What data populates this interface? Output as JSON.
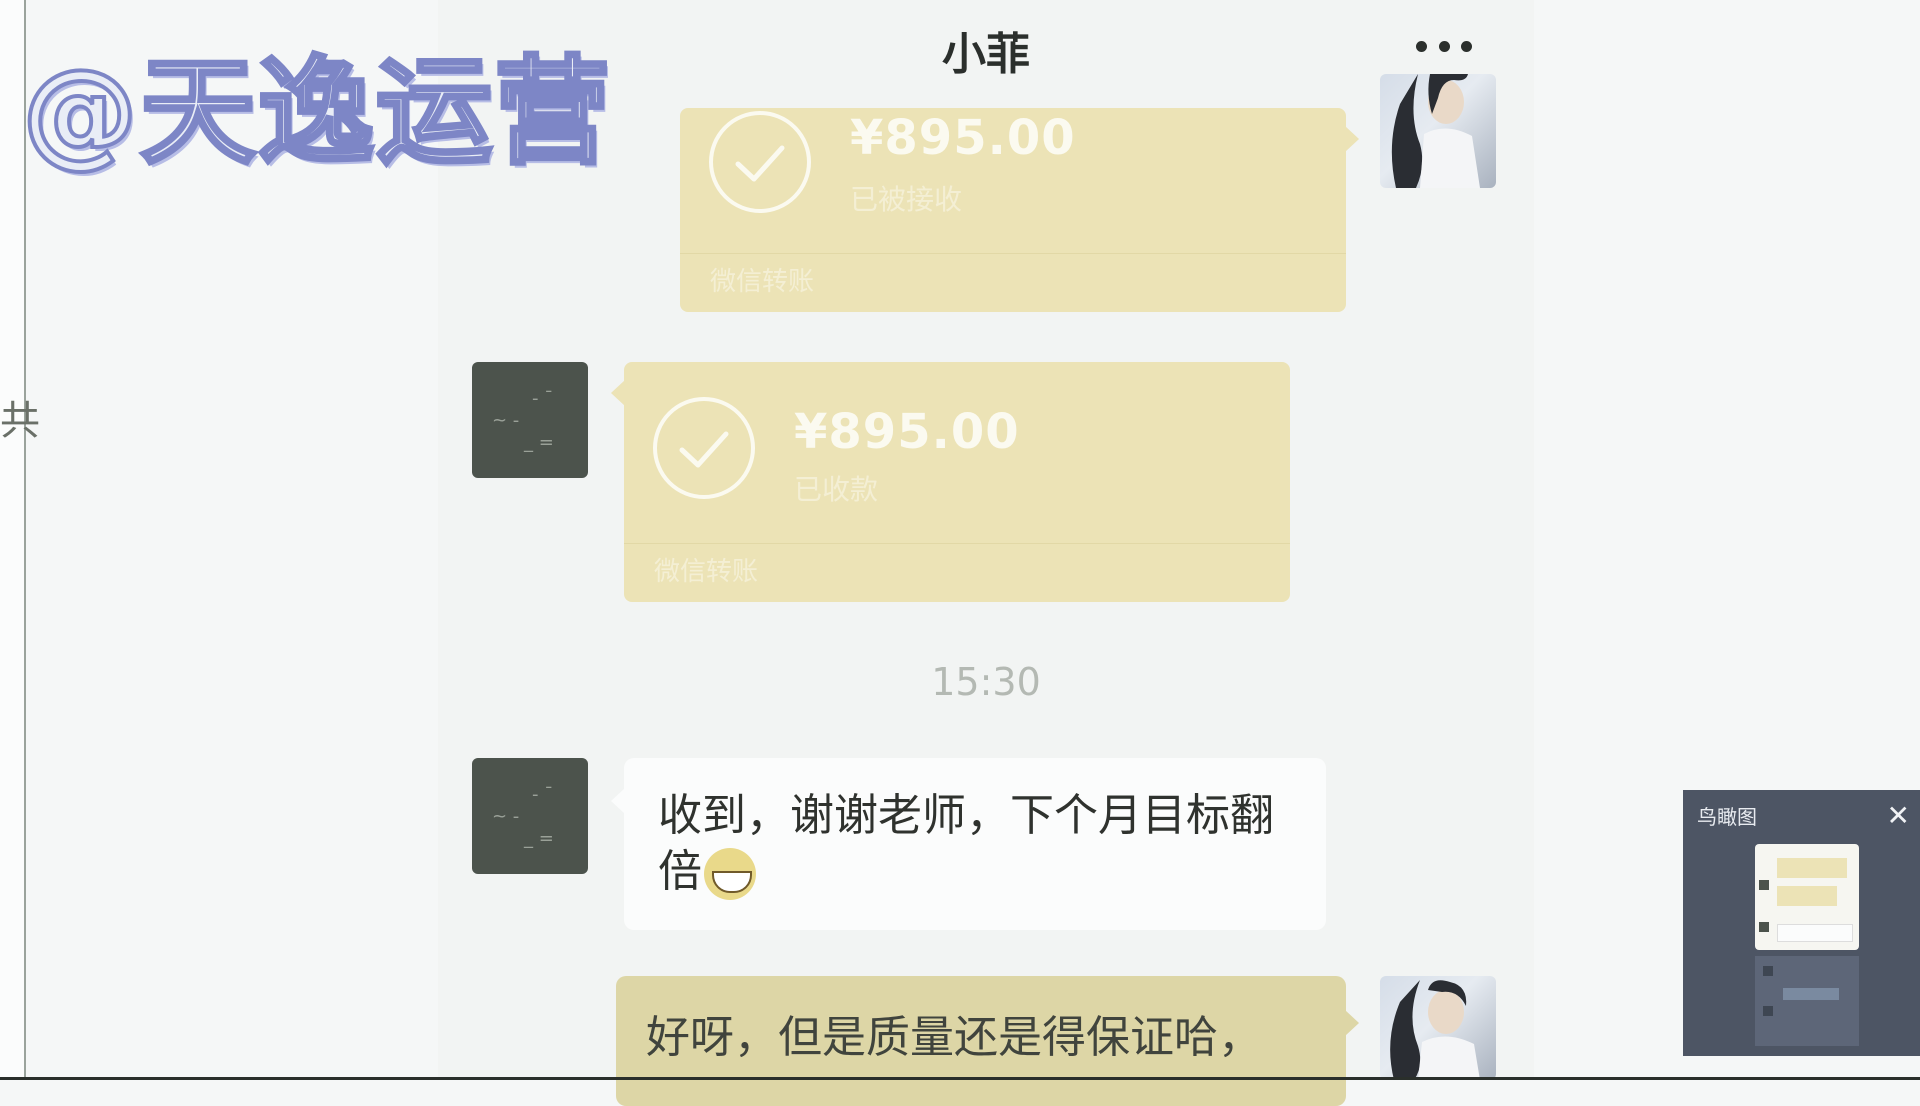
{
  "watermark": "@天逸运营",
  "left_edge_glyph": "共",
  "chat": {
    "title": "小菲",
    "more_icon": "more-dots-icon",
    "time_divider": "15:30"
  },
  "transfers": [
    {
      "amount": "¥895.00",
      "status": "已被接收",
      "brand": "微信转账",
      "direction": "sent"
    },
    {
      "amount": "¥895.00",
      "status": "已收款",
      "brand": "微信转账",
      "direction": "received"
    }
  ],
  "messages": [
    {
      "text_line1": "收到，谢谢老师，下个月目标翻",
      "text_line2": "倍",
      "emoji": "grinning-face-emoji",
      "direction": "received"
    },
    {
      "text": "好呀，但是质量还是得保证哈，",
      "direction": "sent"
    }
  ],
  "mini_panel": {
    "title": "鸟瞰图",
    "close_icon": "close-icon"
  },
  "colors": {
    "transfer_bubble": "#ece3b6",
    "sent_bubble": "#ddd6a6",
    "received_bubble": "#fbfcfc",
    "chat_background": "#f2f4f3",
    "watermark_stroke": "#7d86c6"
  }
}
